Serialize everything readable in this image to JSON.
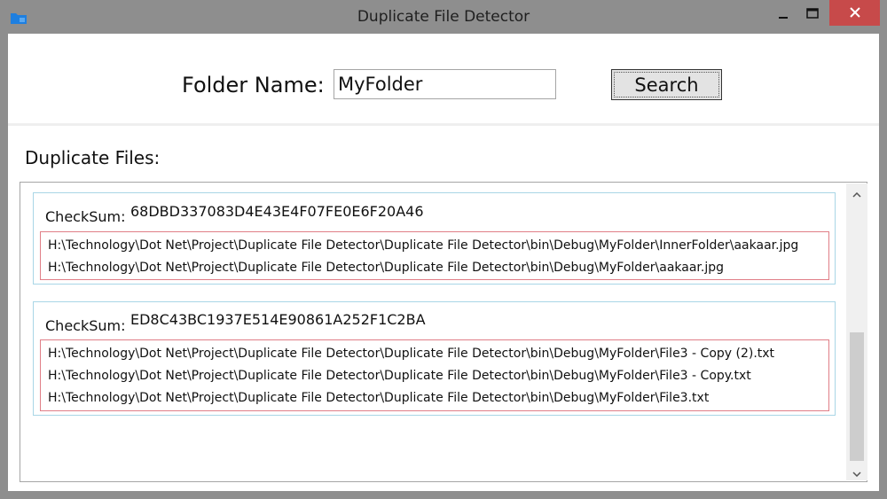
{
  "window": {
    "title": "Duplicate File Detector",
    "icons": {
      "app": "folder-icon",
      "minimize": "minimize-icon",
      "maximize": "maximize-icon",
      "close": "close-icon"
    },
    "colors": {
      "frame": "#8e8e8e",
      "close_button": "#c74a4a"
    }
  },
  "search": {
    "folder_label": "Folder Name:",
    "folder_value": "MyFolder",
    "button_label": "Search"
  },
  "results": {
    "heading": "Duplicate Files:",
    "checksum_label": "CheckSum:",
    "groups": [
      {
        "checksum": "68DBD337083D4E43E4F07FE0E6F20A46",
        "paths": [
          "H:\\Technology\\Dot Net\\Project\\Duplicate File Detector\\Duplicate File Detector\\bin\\Debug\\MyFolder\\InnerFolder\\aakaar.jpg",
          "H:\\Technology\\Dot Net\\Project\\Duplicate File Detector\\Duplicate File Detector\\bin\\Debug\\MyFolder\\aakaar.jpg"
        ]
      },
      {
        "checksum": "ED8C43BC1937E514E90861A252F1C2BA",
        "paths": [
          "H:\\Technology\\Dot Net\\Project\\Duplicate File Detector\\Duplicate File Detector\\bin\\Debug\\MyFolder\\File3 - Copy (2).txt",
          "H:\\Technology\\Dot Net\\Project\\Duplicate File Detector\\Duplicate File Detector\\bin\\Debug\\MyFolder\\File3 - Copy.txt",
          "H:\\Technology\\Dot Net\\Project\\Duplicate File Detector\\Duplicate File Detector\\bin\\Debug\\MyFolder\\File3.txt"
        ]
      }
    ],
    "colors": {
      "group_border": "#a9d6e6",
      "paths_border": "#e07e87"
    }
  }
}
